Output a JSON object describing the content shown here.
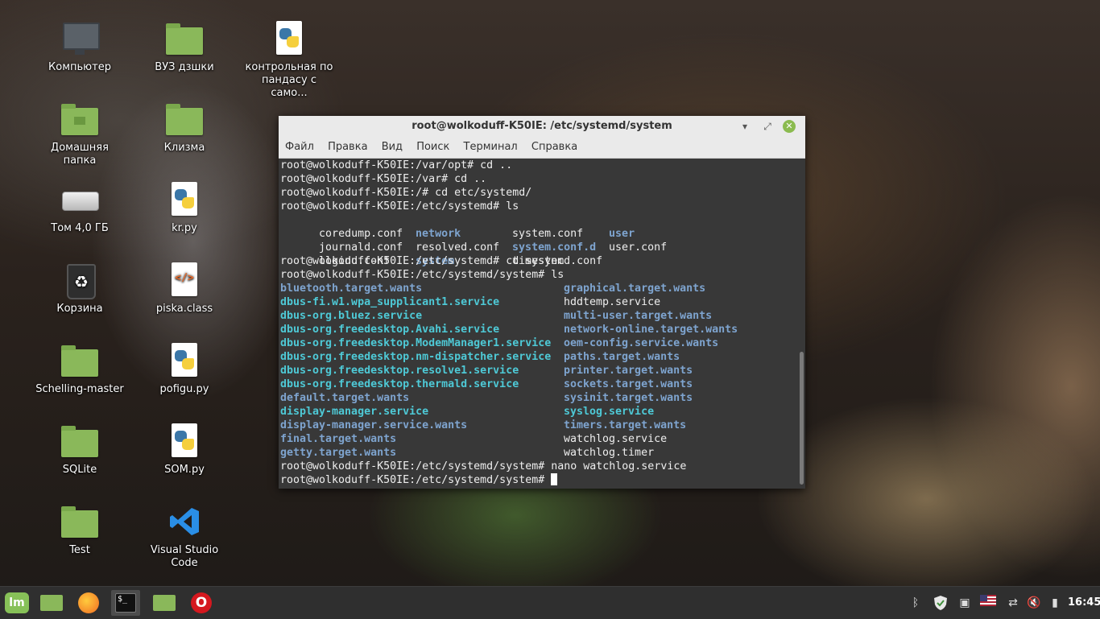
{
  "desktop": {
    "icons": [
      {
        "label": "Компьютер",
        "icon": "computer-icon"
      },
      {
        "label": "ВУЗ дзшки",
        "icon": "folder-icon"
      },
      {
        "label": "контрольная по пандасу с само...",
        "icon": "python-file-icon"
      },
      {
        "label": "Домашняя папка",
        "icon": "home-folder-icon"
      },
      {
        "label": "Клизма",
        "icon": "folder-icon"
      },
      {
        "label": "Том 4,0 ГБ",
        "icon": "drive-icon"
      },
      {
        "label": "kr.py",
        "icon": "python-file-icon"
      },
      {
        "label": "Корзина",
        "icon": "trash-icon"
      },
      {
        "label": "piska.class",
        "icon": "code-file-icon"
      },
      {
        "label": "Schelling-master",
        "icon": "folder-icon"
      },
      {
        "label": "pofigu.py",
        "icon": "python-file-icon"
      },
      {
        "label": "SQLite",
        "icon": "folder-icon"
      },
      {
        "label": "SOM.py",
        "icon": "python-file-icon"
      },
      {
        "label": "Test",
        "icon": "folder-icon"
      },
      {
        "label": "Visual Studio Code",
        "icon": "vscode-icon"
      }
    ]
  },
  "terminal": {
    "title": "root@wolkoduff-K50IE: /etc/systemd/system",
    "menu": [
      "Файл",
      "Правка",
      "Вид",
      "Поиск",
      "Терминал",
      "Справка"
    ],
    "lines": [
      "root@wolkoduff-K50IE:/var/opt# cd ..",
      "root@wolkoduff-K50IE:/var# cd ..",
      "root@wolkoduff-K50IE:/# cd etc/systemd/",
      "root@wolkoduff-K50IE:/etc/systemd# ls"
    ],
    "ls1": [
      [
        "coredump.conf",
        "network",
        "system.conf",
        "user"
      ],
      [
        "journald.conf",
        "resolved.conf",
        "system.conf.d",
        "user.conf"
      ],
      [
        "logind.conf",
        "system",
        "timesyncd.conf",
        ""
      ]
    ],
    "lines2": [
      "root@wolkoduff-K50IE:/etc/systemd# cd system",
      "root@wolkoduff-K50IE:/etc/systemd/system# ls"
    ],
    "ls2": [
      [
        "bluetooth.target.wants",
        "graphical.target.wants"
      ],
      [
        "dbus-fi.w1.wpa_supplicant1.service",
        "hddtemp.service"
      ],
      [
        "dbus-org.bluez.service",
        "multi-user.target.wants"
      ],
      [
        "dbus-org.freedesktop.Avahi.service",
        "network-online.target.wants"
      ],
      [
        "dbus-org.freedesktop.ModemManager1.service",
        "oem-config.service.wants"
      ],
      [
        "dbus-org.freedesktop.nm-dispatcher.service",
        "paths.target.wants"
      ],
      [
        "dbus-org.freedesktop.resolve1.service",
        "printer.target.wants"
      ],
      [
        "dbus-org.freedesktop.thermald.service",
        "sockets.target.wants"
      ],
      [
        "default.target.wants",
        "sysinit.target.wants"
      ],
      [
        "display-manager.service",
        "syslog.service"
      ],
      [
        "display-manager.service.wants",
        "timers.target.wants"
      ],
      [
        "final.target.wants",
        "watchlog.service"
      ],
      [
        "getty.target.wants",
        "watchlog.timer"
      ]
    ],
    "lines3": [
      "root@wolkoduff-K50IE:/etc/systemd/system# nano watchlog.service",
      "root@wolkoduff-K50IE:/etc/systemd/system# "
    ]
  },
  "taskbar": {
    "menu_label": "lm",
    "terminal_label": "$_",
    "opera_label": "O",
    "clock": "16:45"
  },
  "colors": {
    "accent": "#87c158",
    "directory": "#7ea4cf",
    "symlink": "#4ec9d6"
  }
}
